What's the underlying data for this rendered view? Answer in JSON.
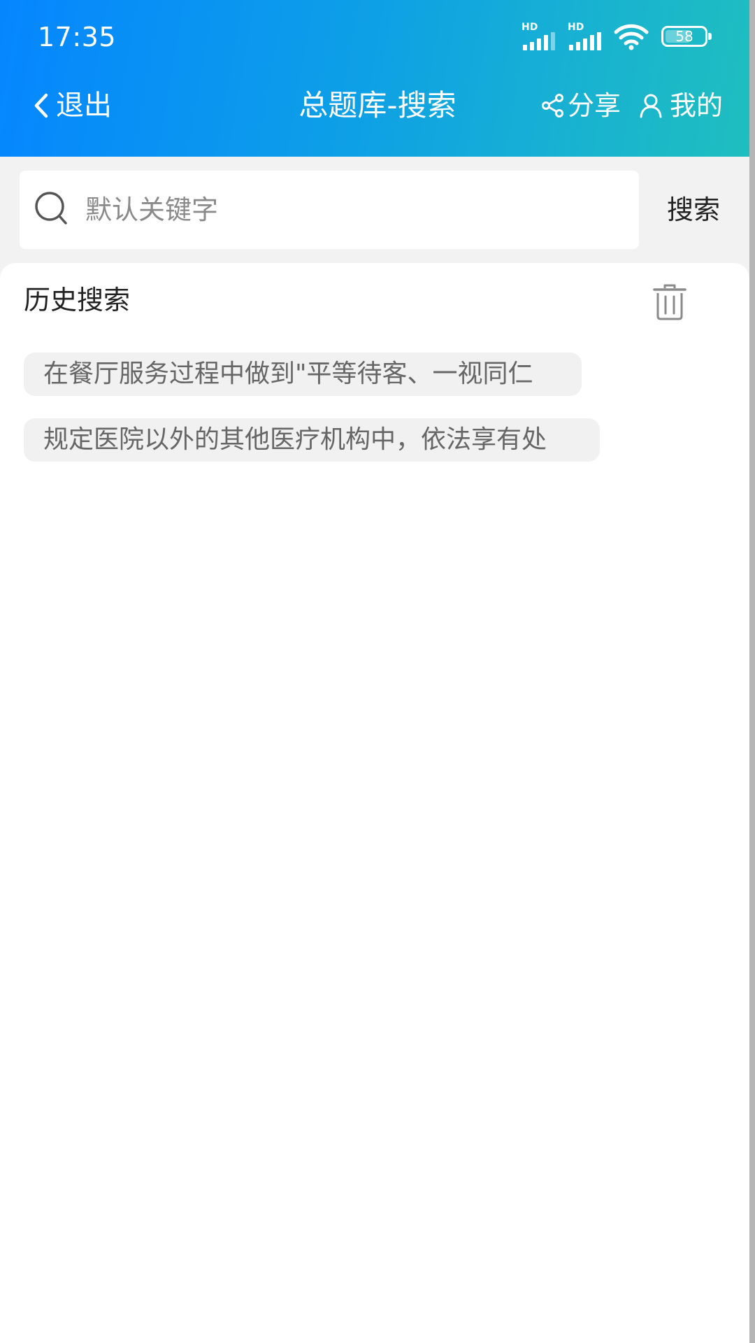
{
  "status_bar": {
    "time": "17:35",
    "signal_labels": [
      "HD",
      "HD"
    ],
    "battery": "58",
    "icons": [
      "signal-icon",
      "signal-icon",
      "wifi-icon",
      "battery-icon"
    ]
  },
  "nav": {
    "back_label": "退出",
    "title": "总题库-搜索",
    "share_label": "分享",
    "mine_label": "我的",
    "icons": [
      "chevron-left-icon",
      "share-icon",
      "user-icon"
    ]
  },
  "search": {
    "placeholder": "默认关键字",
    "value": "",
    "button_label": "搜索",
    "icon": "search-icon"
  },
  "history": {
    "title": "历史搜索",
    "clear_icon": "trash-icon",
    "items": [
      "在餐厅服务过程中做到\"平等待客、一视同仁",
      "规定医院以外的其他医疗机构中，依法享有处"
    ]
  },
  "colors": {
    "header_gradient_start": "#0586ff",
    "header_gradient_end": "#1fbfbe",
    "background": "#f2f2f2",
    "tag_background": "#f1f1f1",
    "tag_text": "#666666"
  }
}
